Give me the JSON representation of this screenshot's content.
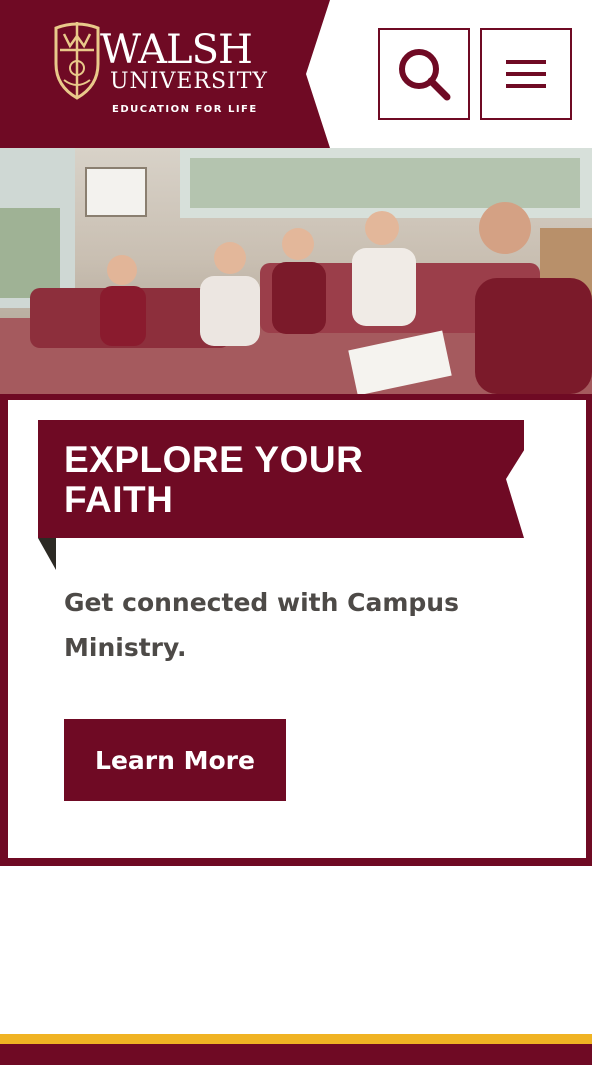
{
  "header": {
    "logo": {
      "name": "WALSH",
      "sub": "UNIVERSITY",
      "tagline": "EDUCATION FOR LIFE"
    },
    "search_icon": "search-icon",
    "menu_icon": "hamburger-menu-icon"
  },
  "hero": {
    "image": "students-sitting-on-couches-photo"
  },
  "promo": {
    "title": "EXPLORE YOUR FAITH",
    "description": "Get connected with Campus Ministry.",
    "button_label": "Learn More"
  },
  "colors": {
    "brand_maroon": "#6f0a24",
    "accent_gold": "#f0b323",
    "text_gray": "#4d4a47"
  }
}
